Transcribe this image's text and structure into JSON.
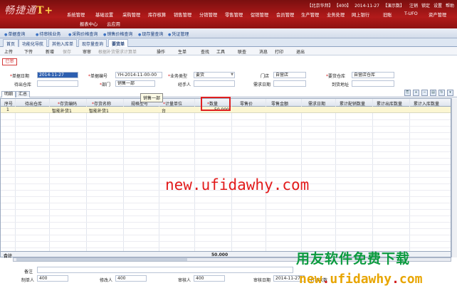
{
  "app": {
    "brand_prefix": "畅捷通",
    "brand_suffix": "T+"
  },
  "top_info": [
    "【北京华邦】",
    "【400】",
    "2014-11-27",
    "【演示数】",
    "注销",
    "锁定",
    "设置",
    "帮助"
  ],
  "main_nav": [
    "系统管理",
    "基础设置",
    "采购管理",
    "库存核算",
    "销售管理",
    "分销管理",
    "零售管理",
    "促销管理",
    "会员管理",
    "生产管理",
    "业务处理",
    "网上银行",
    "旧账",
    "T-UFO",
    "资产管理",
    "报表中心",
    "云应用"
  ],
  "func_bar": [
    "单据查询",
    "待审核业务",
    "采购价格查询",
    "销售价格查询",
    "现存量查询",
    "凭证管理"
  ],
  "tabs": [
    "首页",
    "功能化导航",
    "其他入库单",
    "现存量查询",
    "要货单"
  ],
  "toolbar": [
    "上传",
    "下传",
    "新增",
    "保存",
    "审审",
    "根据补货需求计算单",
    "操作",
    "生单",
    "查找",
    "工具",
    "联查",
    "消息",
    "打印",
    "退出"
  ],
  "status_badge": "已审",
  "form": {
    "doc_date_label": "单据日期",
    "doc_date": "2014-11-27",
    "doc_no_label": "单据编号",
    "doc_no": "YH-2014-11-00-00",
    "biz_type_label": "业务类型",
    "biz_type": "要货",
    "store_label": "门店",
    "store": "自营店",
    "supply_wh_label": "要货仓库",
    "supply_wh": "自营店仓库",
    "out_wh_label": "待出仓库",
    "out_wh": "",
    "dept_label": "部门",
    "dept": "销售一部",
    "handler_label": "经手人",
    "handler": "",
    "need_date_label": "需求日期",
    "need_date": "",
    "arrival_label": "到货地址",
    "arrival": ""
  },
  "sub_tabs": [
    "明细",
    "汇总"
  ],
  "tooltip": "销售一部",
  "grid": {
    "columns": [
      "序号",
      "待出仓库",
      "存货编码",
      "存货名称",
      "规格型号",
      "计量单位",
      "数量",
      "零售价",
      "零售金额",
      "需求日期",
      "累计配销数量",
      "累计出库数量",
      "累计入库数量"
    ],
    "required": [
      false,
      false,
      true,
      true,
      false,
      true,
      true,
      false,
      false,
      false,
      false,
      false,
      false
    ],
    "rows": [
      [
        "1",
        "",
        "智能补货1",
        "智能补货1",
        "",
        "台",
        "50.000",
        "",
        "",
        "",
        "",
        "",
        ""
      ]
    ],
    "total_label": "合计",
    "total_qty": "50.000"
  },
  "watermark": "new.ufidawhy.com",
  "footer": {
    "remark_label": "备注",
    "maker_label": "制单人",
    "maker": "400",
    "reviser_label": "修改人",
    "reviser": "400",
    "auditor_label": "审核人",
    "auditor": "400",
    "audit_date_label": "审核日期",
    "audit_date": "2014-11-27",
    "print_label": "打印次数"
  },
  "promo": {
    "line1": "用友软件免费下载",
    "line2_a": "new",
    "line2_dot": ".",
    "line2_b": "ufidawhy",
    "line2_dot2": ".",
    "line2_c": "com"
  }
}
